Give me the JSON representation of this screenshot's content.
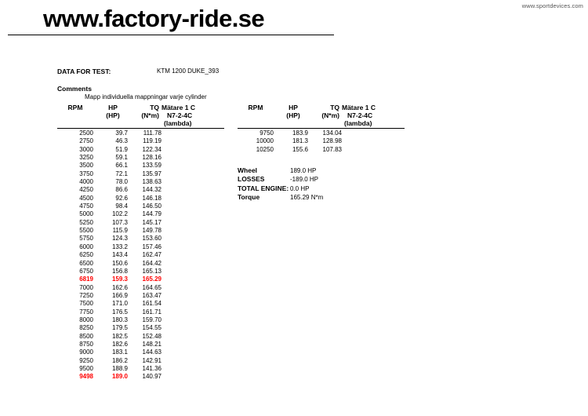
{
  "watermark": "www.sportdevices.com",
  "title": "www.factory-ride.se",
  "info": {
    "data_for_test_label": "DATA FOR TEST:",
    "data_for_test_value": "KTM 1200 DUKE_393",
    "comments_label": "Comments",
    "comments_text": "Mapp individuella mappningar varje cylinder"
  },
  "table_headers": {
    "rpm": "RPM",
    "hp": "HP",
    "hp_unit": "(HP)",
    "tq": "TQ",
    "tq_unit": "(N*m)",
    "channel_line1": "Mätare 1 C",
    "channel_line2": "N7-2-4C",
    "channel_line3": "(lambda)"
  },
  "left_table": [
    {
      "rpm": "2500",
      "hp": "39.7",
      "tq": "111.78",
      "hl": false
    },
    {
      "rpm": "2750",
      "hp": "46.3",
      "tq": "119.19",
      "hl": false
    },
    {
      "rpm": "3000",
      "hp": "51.9",
      "tq": "122.34",
      "hl": false
    },
    {
      "rpm": "3250",
      "hp": "59.1",
      "tq": "128.16",
      "hl": false
    },
    {
      "rpm": "3500",
      "hp": "66.1",
      "tq": "133.59",
      "hl": false
    },
    {
      "rpm": "3750",
      "hp": "72.1",
      "tq": "135.97",
      "hl": false
    },
    {
      "rpm": "4000",
      "hp": "78.0",
      "tq": "138.63",
      "hl": false
    },
    {
      "rpm": "4250",
      "hp": "86.6",
      "tq": "144.32",
      "hl": false
    },
    {
      "rpm": "4500",
      "hp": "92.6",
      "tq": "146.18",
      "hl": false
    },
    {
      "rpm": "4750",
      "hp": "98.4",
      "tq": "146.50",
      "hl": false
    },
    {
      "rpm": "5000",
      "hp": "102.2",
      "tq": "144.79",
      "hl": false
    },
    {
      "rpm": "5250",
      "hp": "107.3",
      "tq": "145.17",
      "hl": false
    },
    {
      "rpm": "5500",
      "hp": "115.9",
      "tq": "149.78",
      "hl": false
    },
    {
      "rpm": "5750",
      "hp": "124.3",
      "tq": "153.60",
      "hl": false
    },
    {
      "rpm": "6000",
      "hp": "133.2",
      "tq": "157.46",
      "hl": false
    },
    {
      "rpm": "6250",
      "hp": "143.4",
      "tq": "162.47",
      "hl": false
    },
    {
      "rpm": "6500",
      "hp": "150.6",
      "tq": "164.42",
      "hl": false
    },
    {
      "rpm": "6750",
      "hp": "156.8",
      "tq": "165.13",
      "hl": false
    },
    {
      "rpm": "6819",
      "hp": "159.3",
      "tq": "165.29",
      "hl": true,
      "tq_red": true
    },
    {
      "rpm": "7000",
      "hp": "162.6",
      "tq": "164.65",
      "hl": false
    },
    {
      "rpm": "7250",
      "hp": "166.9",
      "tq": "163.47",
      "hl": false
    },
    {
      "rpm": "7500",
      "hp": "171.0",
      "tq": "161.54",
      "hl": false
    },
    {
      "rpm": "7750",
      "hp": "176.5",
      "tq": "161.71",
      "hl": false
    },
    {
      "rpm": "8000",
      "hp": "180.3",
      "tq": "159.70",
      "hl": false
    },
    {
      "rpm": "8250",
      "hp": "179.5",
      "tq": "154.55",
      "hl": false
    },
    {
      "rpm": "8500",
      "hp": "182.5",
      "tq": "152.48",
      "hl": false
    },
    {
      "rpm": "8750",
      "hp": "182.6",
      "tq": "148.21",
      "hl": false
    },
    {
      "rpm": "9000",
      "hp": "183.1",
      "tq": "144.63",
      "hl": false
    },
    {
      "rpm": "9250",
      "hp": "186.2",
      "tq": "142.91",
      "hl": false
    },
    {
      "rpm": "9500",
      "hp": "188.9",
      "tq": "141.36",
      "hl": false
    },
    {
      "rpm": "9498",
      "hp": "189.0",
      "tq": "140.97",
      "hl": true,
      "tq_red": false
    }
  ],
  "right_table": [
    {
      "rpm": "9750",
      "hp": "183.9",
      "tq": "134.04",
      "hl": false
    },
    {
      "rpm": "10000",
      "hp": "181.3",
      "tq": "128.98",
      "hl": false
    },
    {
      "rpm": "10250",
      "hp": "155.6",
      "tq": "107.83",
      "hl": false
    }
  ],
  "summary": [
    {
      "label": "Wheel",
      "value": "189.0 HP"
    },
    {
      "label": "LOSSES",
      "value": "-189.0 HP"
    },
    {
      "label": "TOTAL ENGINE:",
      "value": "0.0 HP"
    },
    {
      "label": "Torque",
      "value": "165.29 N*m"
    }
  ]
}
